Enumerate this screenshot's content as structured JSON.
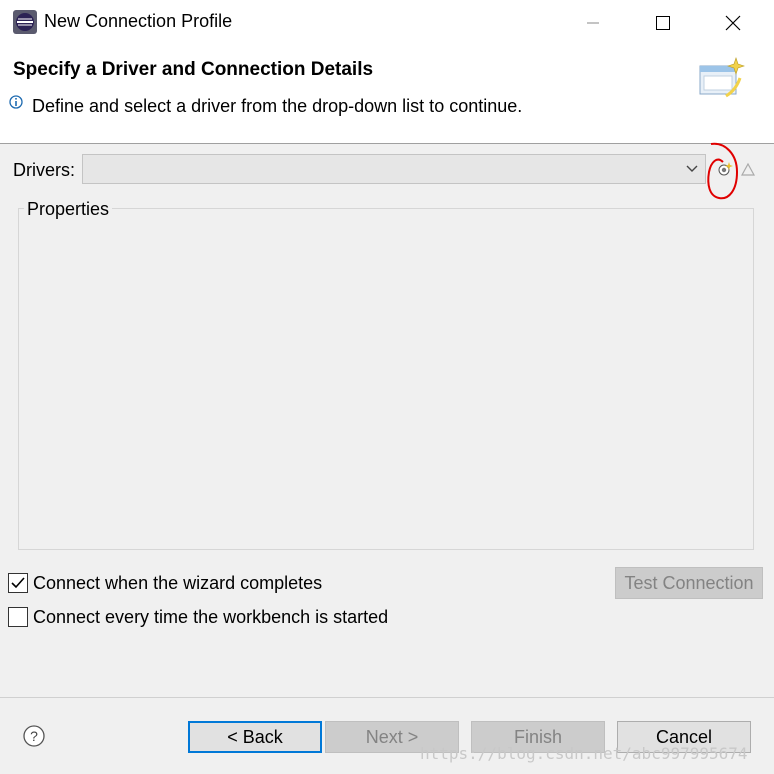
{
  "window": {
    "title": "New Connection Profile"
  },
  "header": {
    "title": "Specify a Driver and Connection Details",
    "description": "Define and select a driver from the drop-down list to continue."
  },
  "drivers": {
    "label": "Drivers:",
    "selected_value": ""
  },
  "properties": {
    "label": "Properties"
  },
  "options": {
    "connect_on_complete": {
      "label": "Connect when the wizard completes",
      "checked": true
    },
    "connect_on_startup": {
      "label": "Connect every time the workbench is started",
      "checked": false
    }
  },
  "test_connection_label": "Test Connection",
  "buttons": {
    "back": "< Back",
    "next": "Next >",
    "finish": "Finish",
    "cancel": "Cancel"
  },
  "watermark": "https://blog.csdn.net/abc997995674",
  "colors": {
    "accent": "#0078d7",
    "annotation": "#e00000"
  }
}
